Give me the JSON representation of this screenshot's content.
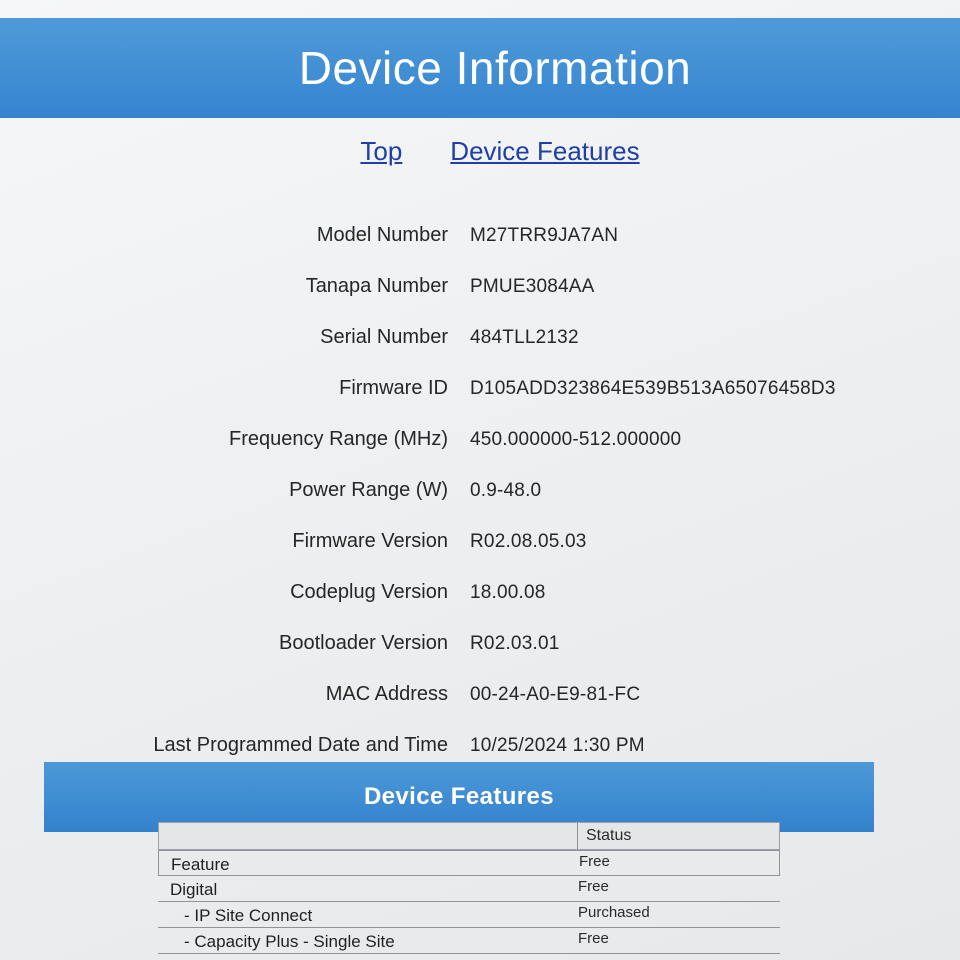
{
  "header": {
    "title": "Device Information"
  },
  "nav": {
    "top": "Top",
    "features": "Device Features"
  },
  "info": [
    {
      "label": "Model Number",
      "value": "M27TRR9JA7AN"
    },
    {
      "label": "Tanapa Number",
      "value": "PMUE3084AA"
    },
    {
      "label": "Serial Number",
      "value": "484TLL2132"
    },
    {
      "label": "Firmware ID",
      "value": "D105ADD323864E539B513A65076458D3"
    },
    {
      "label": "Frequency Range (MHz)",
      "value": "450.000000-512.000000"
    },
    {
      "label": "Power Range (W)",
      "value": "0.9-48.0"
    },
    {
      "label": "Firmware Version",
      "value": "R02.08.05.03"
    },
    {
      "label": "Codeplug Version",
      "value": "18.00.08"
    },
    {
      "label": "Bootloader Version",
      "value": "R02.03.01"
    },
    {
      "label": "MAC Address",
      "value": "00-24-A0-E9-81-FC"
    },
    {
      "label": "Last Programmed Date and Time",
      "value": "10/25/2024 1:30 PM"
    }
  ],
  "features": {
    "title": "Device Features",
    "status_header": "Status",
    "feature_header": "Feature",
    "rows": [
      {
        "name": "",
        "status": "Free"
      },
      {
        "name": "Digital",
        "status": "Free"
      },
      {
        "name": "- IP Site Connect",
        "status": "Purchased"
      },
      {
        "name": "- Capacity Plus - Single Site",
        "status": "Free"
      }
    ]
  }
}
